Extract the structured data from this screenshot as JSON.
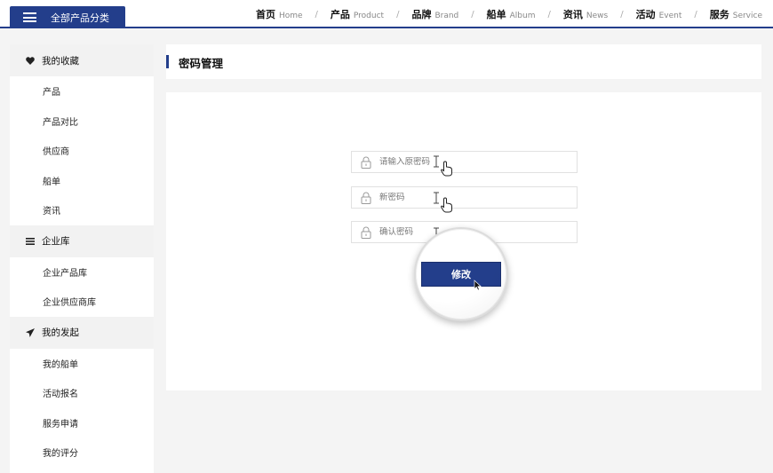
{
  "header": {
    "category_label": "全部产品分类",
    "nav": [
      {
        "cn": "首页",
        "en": "Home"
      },
      {
        "cn": "产品",
        "en": "Product"
      },
      {
        "cn": "品牌",
        "en": "Brand"
      },
      {
        "cn": "船单",
        "en": "Album"
      },
      {
        "cn": "资讯",
        "en": "News"
      },
      {
        "cn": "活动",
        "en": "Event"
      },
      {
        "cn": "服务",
        "en": "Service"
      }
    ],
    "separator": "/"
  },
  "sidebar": {
    "sections": [
      {
        "title": "我的收藏",
        "icon": "heart-icon",
        "items": [
          "产品",
          "产品对比",
          "供应商",
          "船单",
          "资讯"
        ]
      },
      {
        "title": "企业库",
        "icon": "list-icon",
        "items": [
          "企业产品库",
          "企业供应商库"
        ]
      },
      {
        "title": "我的发起",
        "icon": "paper-plane-icon",
        "items": [
          "我的船单",
          "活动报名",
          "服务申请",
          "我的评分"
        ]
      }
    ]
  },
  "main": {
    "title": "密码管理",
    "fields": {
      "old_password": {
        "placeholder": "请输入原密码",
        "icon": "lock-icon"
      },
      "new_password": {
        "placeholder": "新密码",
        "icon": "lock-icon"
      },
      "confirm_password": {
        "placeholder": "确认密码",
        "icon": "lock-icon"
      }
    },
    "submit_label": "修改"
  },
  "colors": {
    "accent": "#233e8b",
    "panel": "#ffffff",
    "background": "#f4f4f4"
  }
}
